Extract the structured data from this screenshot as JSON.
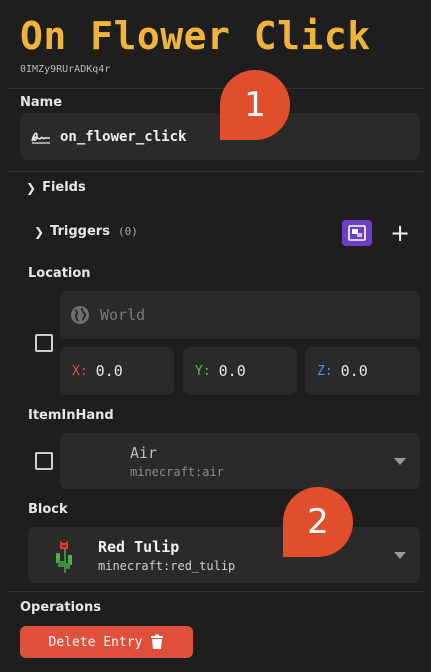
{
  "header": {
    "title": "On Flower Click",
    "entry_id": "0IMZy9RUrADKq4r"
  },
  "name_field": {
    "label": "Name",
    "value": "on_flower_click"
  },
  "badges": [
    "1",
    "2"
  ],
  "fields_section": {
    "label": "Fields"
  },
  "triggers": {
    "label": "Triggers",
    "count": "(0)"
  },
  "location": {
    "label": "Location",
    "world_placeholder": "World",
    "x_label": "X:",
    "x_value": "0.0",
    "y_label": "Y:",
    "y_value": "0.0",
    "z_label": "Z:",
    "z_value": "0.0"
  },
  "item_in_hand": {
    "label": "ItemInHand",
    "name": "Air",
    "id": "minecraft:air"
  },
  "block": {
    "label": "Block",
    "name": "Red Tulip",
    "id": "minecraft:red_tulip"
  },
  "operations": {
    "label": "Operations",
    "delete_label": "Delete Entry"
  },
  "colors": {
    "accent": "#f0b43c",
    "badge": "#e04e2b",
    "delete": "#e04e3c",
    "purple": "#6d3fc7",
    "x_axis": "#d9534f",
    "y_axis": "#5cb85c",
    "z_axis": "#5b8fd9"
  }
}
